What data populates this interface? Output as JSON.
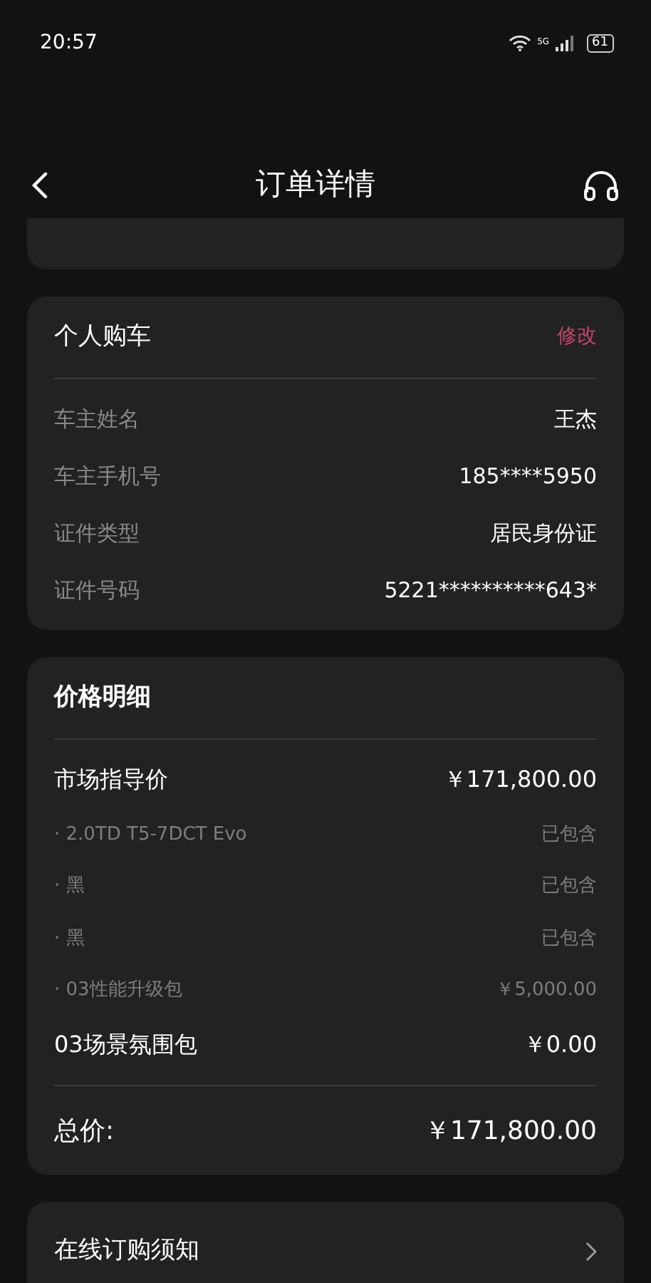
{
  "status_bar": {
    "time": "20:57",
    "network": "5G",
    "battery": "61"
  },
  "header": {
    "title": "订单详情"
  },
  "buyer": {
    "title": "个人购车",
    "action": "修改",
    "rows": [
      {
        "label": "车主姓名",
        "value": "王杰"
      },
      {
        "label": "车主手机号",
        "value": "185****5950"
      },
      {
        "label": "证件类型",
        "value": "居民身份证"
      },
      {
        "label": "证件号码",
        "value": "5221**********643*"
      }
    ]
  },
  "price": {
    "title": "价格明细",
    "rows": [
      {
        "kind": "main",
        "label": "市场指导价",
        "value": "￥171,800.00"
      },
      {
        "kind": "sub",
        "label": "· 2.0TD T5-7DCT Evo",
        "value": "已包含"
      },
      {
        "kind": "sub",
        "label": "· 黑",
        "value": "已包含"
      },
      {
        "kind": "sub",
        "label": "· 黑",
        "value": "已包含"
      },
      {
        "kind": "sub",
        "label": "· 03性能升级包",
        "value": "￥5,000.00"
      },
      {
        "kind": "main",
        "label": "03场景氛围包",
        "value": "￥0.00"
      }
    ],
    "total_label": "总价:",
    "total_value": "￥171,800.00"
  },
  "notice": {
    "title": "在线订购须知"
  }
}
